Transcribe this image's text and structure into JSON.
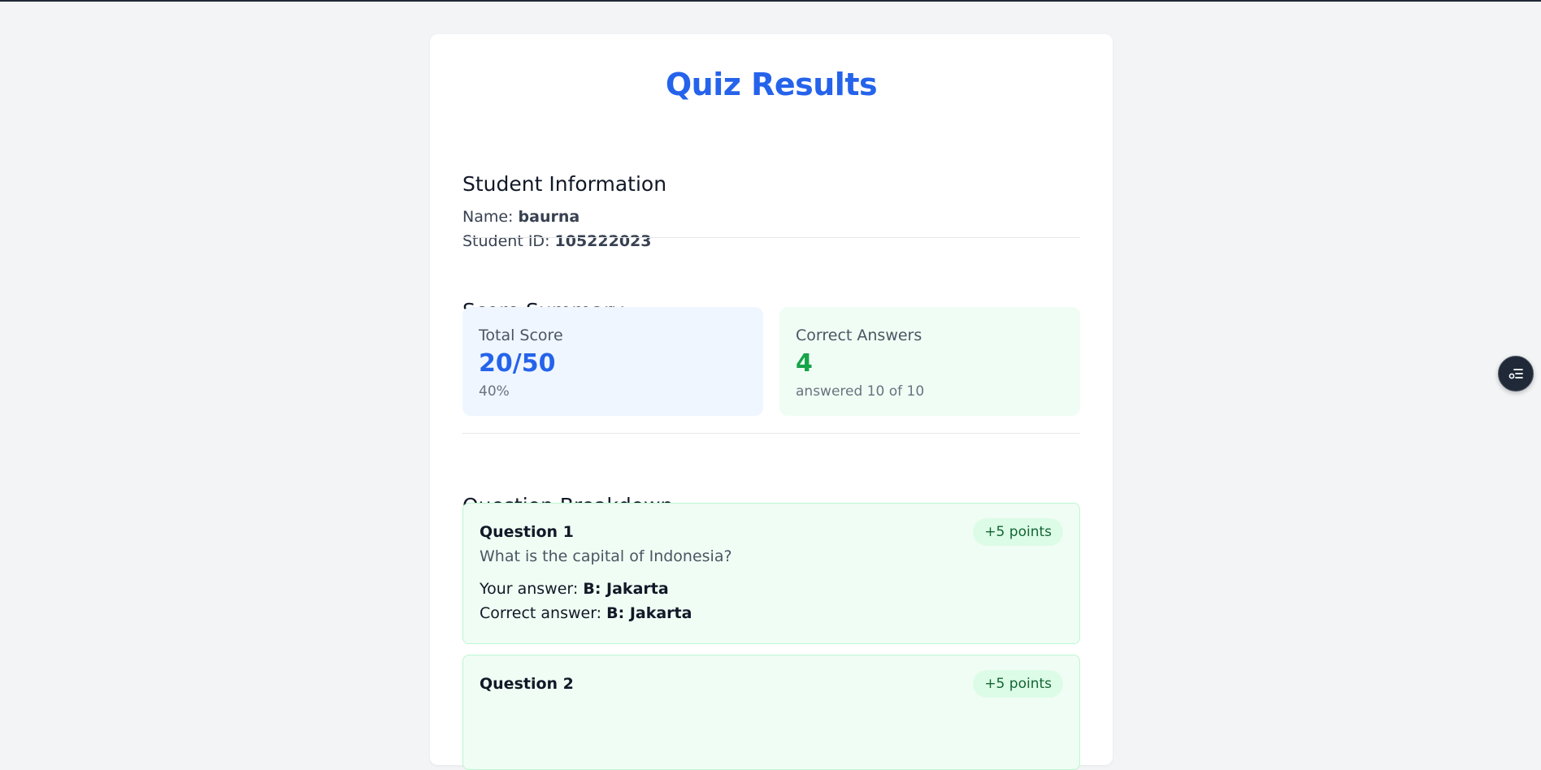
{
  "page": {
    "title": "Quiz Results"
  },
  "student": {
    "heading": "Student Information",
    "name_label": "Name:",
    "name_value": "baurna",
    "id_label": "Student ID:",
    "id_value": "105222023"
  },
  "summary": {
    "heading": "Score Summary",
    "total": {
      "label": "Total Score",
      "value": "20/50",
      "sub": "40%"
    },
    "correct": {
      "label": "Correct Answers",
      "value": "4",
      "sub": "answered 10 of 10"
    }
  },
  "breakdown": {
    "heading": "Question Breakdown",
    "questions": [
      {
        "title": "Question 1",
        "text": "What is the capital of Indonesia?",
        "badge": "+5 points",
        "your_label": "Your answer:",
        "your_value": "B: Jakarta",
        "correct_label": "Correct answer:",
        "correct_value": "B: Jakarta"
      },
      {
        "title": "Question 2",
        "badge": "+5 points"
      }
    ]
  },
  "floating_button": {
    "icon": "list-settings-icon"
  },
  "colors": {
    "accent": "#2563eb",
    "success": "#16a34a",
    "background": "#f3f4f6"
  }
}
